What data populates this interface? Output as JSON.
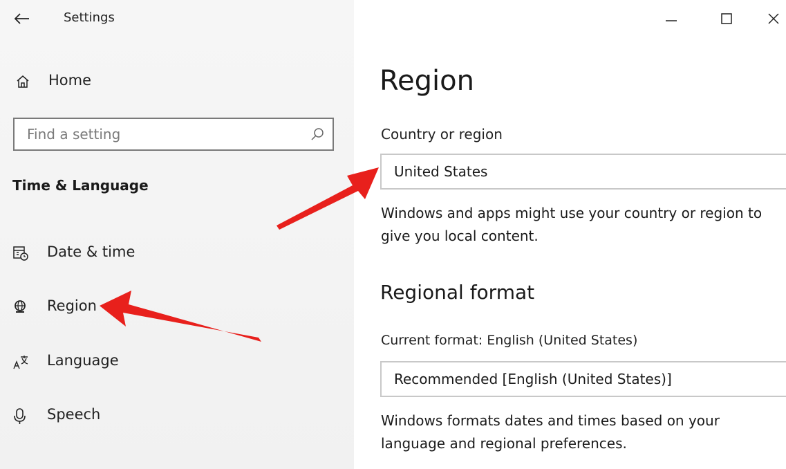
{
  "window": {
    "title": "Settings",
    "buttons": {
      "minimize": "—",
      "maximize": "☐",
      "close": "✕"
    }
  },
  "sidebar": {
    "home_label": "Home",
    "search_placeholder": "Find a setting",
    "section_title": "Time & Language",
    "items": [
      {
        "label": "Date & time",
        "icon": "calendar-clock-icon"
      },
      {
        "label": "Region",
        "icon": "globe-region-icon"
      },
      {
        "label": "Language",
        "icon": "language-icon"
      },
      {
        "label": "Speech",
        "icon": "microphone-icon"
      }
    ]
  },
  "main": {
    "title": "Region",
    "country_label": "Country or region",
    "country_value": "United States",
    "country_description": "Windows and apps might use your country or region to give you local content.",
    "regional_format_title": "Regional format",
    "current_format_label": "Current format: English (United States)",
    "format_value": "Recommended [English (United States)]",
    "format_description": "Windows formats dates and times based on your language and regional preferences."
  },
  "annotations": {
    "arrow_color": "#e8201c",
    "arrows": [
      "points-to-country-dropdown",
      "points-to-region-nav-item"
    ]
  },
  "colors": {
    "sidebar_bg": "#f3f3f3",
    "search_border": "#7a7a7a",
    "dropdown_border": "#c8c8c8"
  }
}
